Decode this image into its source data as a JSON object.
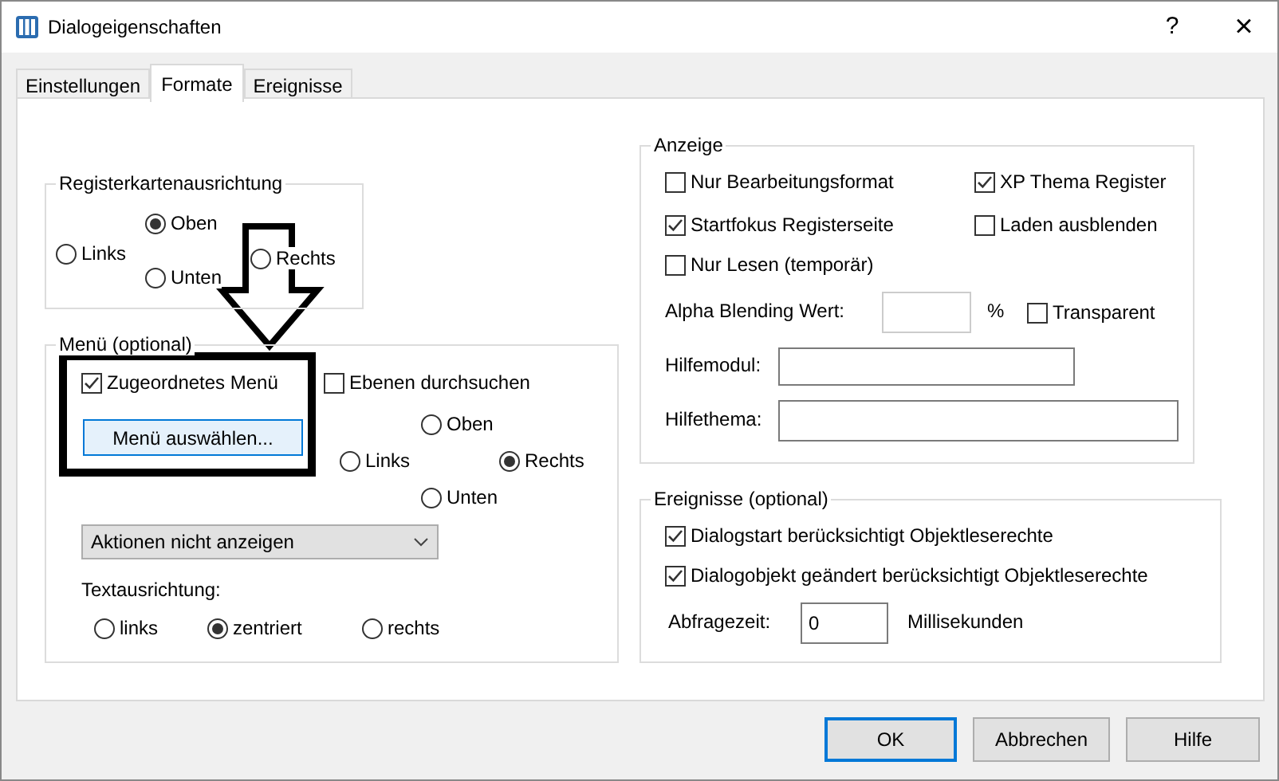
{
  "window": {
    "title": "Dialogeigenschaften",
    "help": "?",
    "close": "×"
  },
  "tabs": [
    {
      "label": "Einstellungen",
      "selected": false
    },
    {
      "label": "Formate",
      "selected": true
    },
    {
      "label": "Ereignisse",
      "selected": false
    }
  ],
  "tab_alignment": {
    "label": "Registerkartenausrichtung",
    "options": [
      {
        "label": "Links",
        "selected": false
      },
      {
        "label": "Oben",
        "selected": true
      },
      {
        "label": "Unten",
        "selected": false
      },
      {
        "label": "Rechts",
        "selected": false
      }
    ]
  },
  "menu": {
    "label": "Menü (optional)",
    "assigned_menu": {
      "label": "Zugeordnetes Menü",
      "checked": true
    },
    "select_button": "Menü auswählen...",
    "search_levels": {
      "label": "Ebenen durchsuchen",
      "checked": false
    },
    "position_options": [
      {
        "label": "Oben",
        "selected": false
      },
      {
        "label": "Links",
        "selected": false
      },
      {
        "label": "Rechts",
        "selected": true
      },
      {
        "label": "Unten",
        "selected": false
      }
    ],
    "actions_dropdown": {
      "value": "Aktionen nicht anzeigen"
    },
    "text_alignment": {
      "label": "Textausrichtung:",
      "options": [
        {
          "label": "links",
          "selected": false
        },
        {
          "label": "zentriert",
          "selected": true
        },
        {
          "label": "rechts",
          "selected": false
        }
      ]
    }
  },
  "display": {
    "label": "Anzeige",
    "checkboxes": [
      {
        "label": "Nur Bearbeitungsformat",
        "checked": false
      },
      {
        "label": "XP Thema Register",
        "checked": true
      },
      {
        "label": "Startfokus Registerseite",
        "checked": true
      },
      {
        "label": "Laden ausblenden",
        "checked": false
      },
      {
        "label": "Nur Lesen (temporär)",
        "checked": false
      }
    ],
    "alpha": {
      "label": "Alpha Blending Wert:",
      "unit": "%"
    },
    "transparent": {
      "label": "Transparent",
      "checked": false
    },
    "help_module": {
      "label": "Hilfemodul:"
    },
    "help_topic": {
      "label": "Hilfethema:"
    }
  },
  "events": {
    "label": "Ereignisse (optional)",
    "checkboxes": [
      {
        "label": "Dialogstart berücksichtigt Objektleserechte",
        "checked": true
      },
      {
        "label": "Dialogobjekt geändert berücksichtigt Objektleserechte",
        "checked": true
      }
    ],
    "polling": {
      "label": "Abfragezeit:",
      "value": "0",
      "unit": "Millisekunden"
    }
  },
  "buttons": [
    {
      "label": "OK",
      "kind": "default"
    },
    {
      "label": "Abbrechen",
      "kind": "normal"
    },
    {
      "label": "Hilfe",
      "kind": "normal"
    }
  ]
}
